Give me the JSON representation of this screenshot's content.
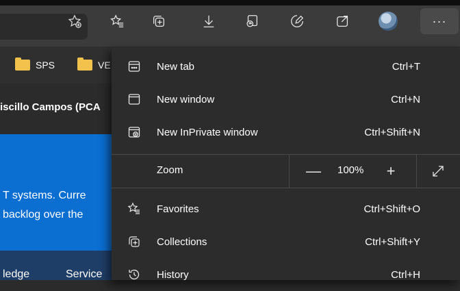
{
  "toolbar": {
    "icons": [
      "add-favorite-icon",
      "favorites-icon",
      "collections-icon",
      "downloads-icon",
      "internet-explorer-mode-icon",
      "browser-essentials-icon",
      "share-icon",
      "profile-avatar",
      "more-options-icon"
    ],
    "more_label": "···"
  },
  "favorites_bar": {
    "items": [
      {
        "label": "SPS",
        "icon": "folder-icon"
      },
      {
        "label": "VE",
        "icon": "folder-icon"
      }
    ]
  },
  "page": {
    "title": "iscillo Campos (PCA",
    "body_line1": "T systems. Curre",
    "body_line2": "backlog over the",
    "nav1": "ledge",
    "nav2": "Service"
  },
  "menu": {
    "items": [
      {
        "label": "New tab",
        "shortcut": "Ctrl+T",
        "icon": "new-tab-icon"
      },
      {
        "label": "New window",
        "shortcut": "Ctrl+N",
        "icon": "new-window-icon"
      },
      {
        "label": "New InPrivate window",
        "shortcut": "Ctrl+Shift+N",
        "icon": "inprivate-icon"
      },
      {
        "label": "Favorites",
        "shortcut": "Ctrl+Shift+O",
        "icon": "favorites-icon"
      },
      {
        "label": "Collections",
        "shortcut": "Ctrl+Shift+Y",
        "icon": "collections-icon"
      },
      {
        "label": "History",
        "shortcut": "Ctrl+H",
        "icon": "history-icon"
      }
    ],
    "zoom": {
      "label": "Zoom",
      "value": "100%",
      "minus": "—",
      "plus": "+"
    }
  },
  "colors": {
    "accent_blue": "#0b6ed1",
    "folder": "#f3c24d",
    "menu_bg": "#2c2c2c"
  }
}
